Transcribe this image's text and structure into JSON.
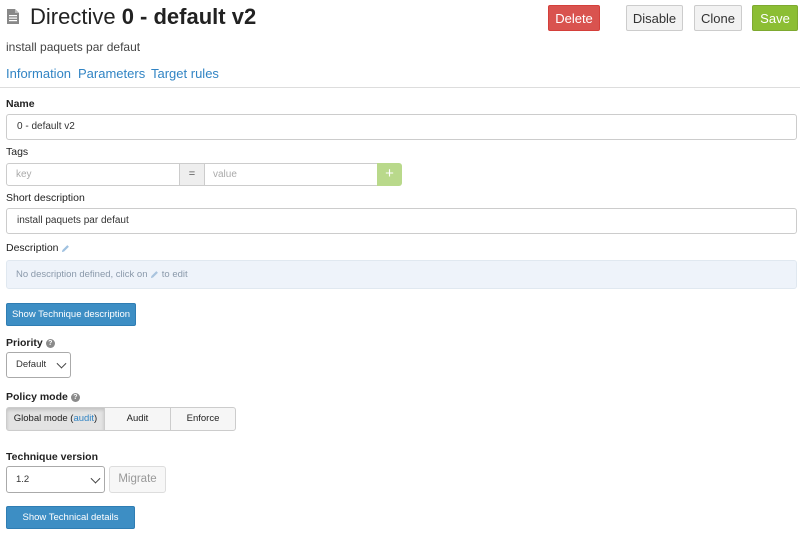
{
  "header": {
    "title_prefix": "Directive",
    "title_name": "0 - default v2",
    "subtitle": "install paquets par defaut",
    "buttons": {
      "delete": "Delete",
      "disable": "Disable",
      "clone": "Clone",
      "save": "Save"
    }
  },
  "tabs": [
    {
      "label": "Information"
    },
    {
      "label": "Parameters"
    },
    {
      "label": "Target rules"
    }
  ],
  "form": {
    "name_label": "Name",
    "name_value": "0 - default v2",
    "tags_label": "Tags",
    "tag_key_placeholder": "key",
    "tag_equals": "=",
    "tag_value_placeholder": "value",
    "tag_add": "+",
    "short_desc_label": "Short description",
    "short_desc_value": "install paquets par defaut",
    "description_label": "Description",
    "description_empty_prefix": "No description defined, click on",
    "description_empty_suffix": "to edit",
    "show_technique_desc": "Show Technique description",
    "priority_label": "Priority",
    "priority_value": "Default",
    "policy_mode_label": "Policy mode",
    "policy_modes": {
      "global_prefix": "Global mode (",
      "global_link": "audit",
      "global_suffix": ")",
      "audit": "Audit",
      "enforce": "Enforce"
    },
    "technique_version_label": "Technique version",
    "technique_version_value": "1.2",
    "migrate": "Migrate",
    "show_technical_details": "Show Technical details"
  },
  "colors": {
    "delete": "#d9534f",
    "save": "#8cbe34",
    "link": "#3184c4",
    "primary": "#3d8ec4",
    "description_bg": "#eef3fa"
  }
}
